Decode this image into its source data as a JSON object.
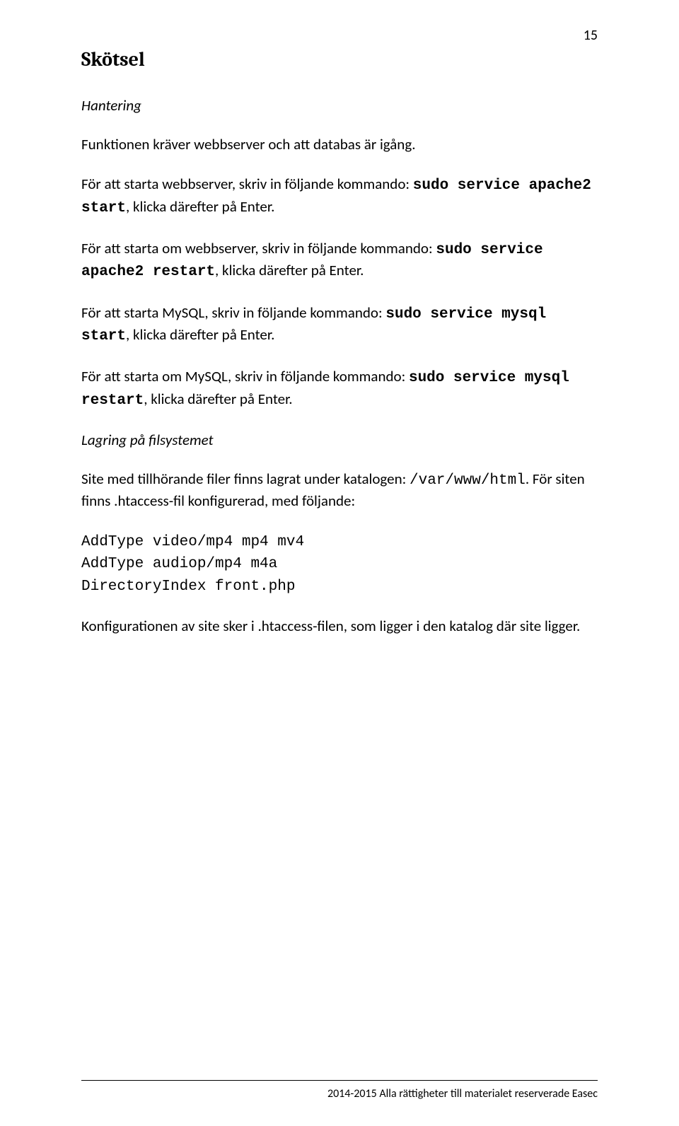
{
  "page_number": "15",
  "title": "Skötsel",
  "section1_heading": "Hantering",
  "p_intro": "Funktionen kräver webbserver och att databas är igång.",
  "p_web_start_pre": "För att starta webbserver, skriv in följande kommando: ",
  "cmd_web_start": "sudo service apache2 start",
  "p_post_enter": ", klicka därefter på Enter.",
  "p_web_restart_pre": "För att starta om webbserver, skriv in följande kommando: ",
  "cmd_web_restart": "sudo service apache2 restart",
  "p_mysql_start_pre": "För att starta MySQL, skriv in följande kommando: ",
  "cmd_mysql_start": "sudo service mysql start",
  "p_mysql_restart_pre": "För att starta om MySQL, skriv in följande kommando: ",
  "cmd_mysql_restart": "sudo service mysql restart",
  "section2_heading": "Lagring på filsystemet",
  "p_site_pre": "Site med tillhörande filer finns lagrat under katalogen: ",
  "path_var": "/var/www/html",
  "p_site_mid": ". För siten finns .htaccess-fil konfigurerad, med följande:",
  "htaccess_line1": "AddType video/mp4 mp4 mv4",
  "htaccess_line2": "AddType audiop/mp4 m4a",
  "htaccess_line3": "DirectoryIndex front.php",
  "p_config": "Konfigurationen av site sker i .htaccess-filen, som ligger i den katalog där site ligger.",
  "footer": "2014-2015 Alla rättigheter till materialet reserverade Easec"
}
